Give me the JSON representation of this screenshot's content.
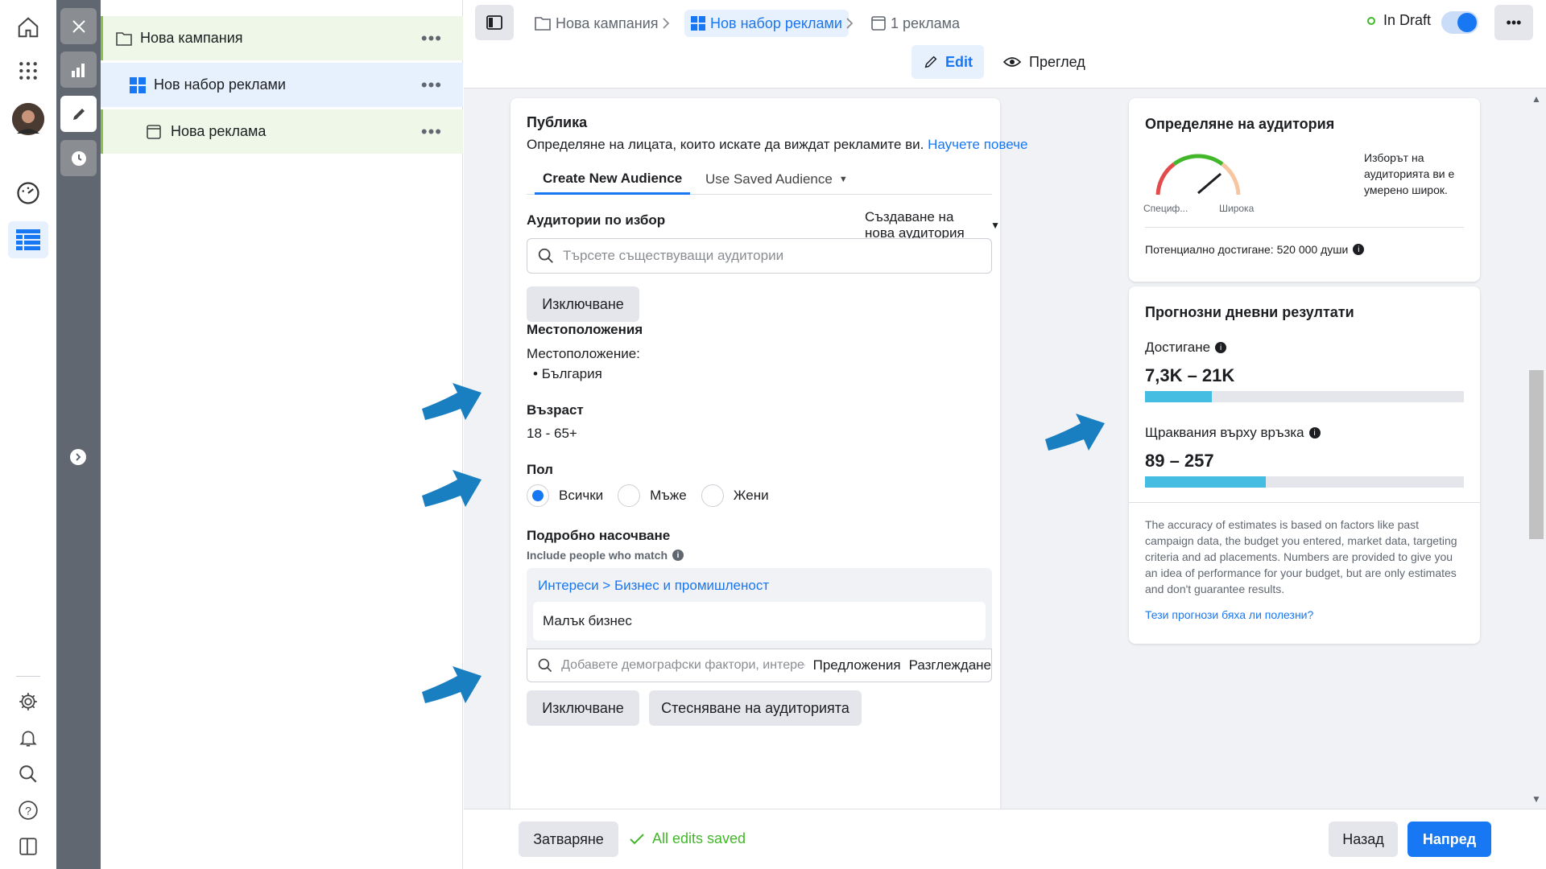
{
  "tree": {
    "campaign": "Нова кампания",
    "adset": "Нов набор реклами",
    "ad": "Нова реклама",
    "dots": "•••"
  },
  "breadcrumb": {
    "campaign": "Нова кампания",
    "adset": "Нов набор реклами",
    "ad": "1 реклама"
  },
  "status": {
    "label": "In Draft",
    "toggle_on": true
  },
  "mode_tabs": {
    "edit": "Edit",
    "preview": "Преглед"
  },
  "audience": {
    "title": "Публика",
    "subtitle": "Определяне на лицата, които искате да виждат рекламите ви.",
    "learn_more": "Научете повече",
    "tabs": [
      "Create New Audience",
      "Use Saved Audience"
    ],
    "custom_label": "Аудитории по избор",
    "create_new": "Създаване на нова аудитория",
    "search_placeholder": "Търсете съществуващи аудитории",
    "exclude_btn": "Изключване",
    "locations_title": "Местоположения",
    "location_label": "Местоположение:",
    "location_value": "България",
    "age_title": "Възраст",
    "age_value": "18 - 65+",
    "gender_title": "Пол",
    "gender_options": [
      "Всички",
      "Мъже",
      "Жени"
    ],
    "gender_selected": "Всички",
    "detailed_title": "Подробно насочване",
    "include_label": "Include people who match",
    "interest_path_1": "Интереси",
    "interest_sep": ">",
    "interest_path_2": "Бизнес и промишленост",
    "interest_item": "Малък бизнес",
    "detailed_placeholder": "Добавете демографски фактори, интереси или п...",
    "suggestions": "Предложения",
    "browse": "Разглеждане",
    "exclude_btn2": "Изключване",
    "narrow_btn": "Стесняване на аудиторията"
  },
  "definition": {
    "title": "Определяне на аудитория",
    "specific": "Специф...",
    "broad": "Широка",
    "note": "Изборът на аудиторията ви е умерено широк.",
    "reach_line": "Потенциално достигане: 520 000 души"
  },
  "estimates": {
    "title": "Прогнозни дневни резултати",
    "reach_label": "Достигане",
    "reach_value": "7,3K – 21K",
    "reach_fill": 0.21,
    "clicks_label": "Щраквания върху връзка",
    "clicks_value": "89 – 257",
    "clicks_fill": 0.38,
    "disclaimer": "The accuracy of estimates is based on factors like past campaign data, the budget you entered, market data, targeting criteria and ad placements. Numbers are provided to give you an idea of performance for your budget, but are only estimates and don't guarantee results.",
    "feedback_link": "Тези прогнози бяха ли полезни?"
  },
  "footer": {
    "close": "Затваряне",
    "saved": "All edits saved",
    "back": "Назад",
    "next": "Напред"
  },
  "colors": {
    "accent": "#1877f2",
    "arrow": "#1a7fc1",
    "bar": "#45bde3",
    "green_status": "#42b72a"
  }
}
